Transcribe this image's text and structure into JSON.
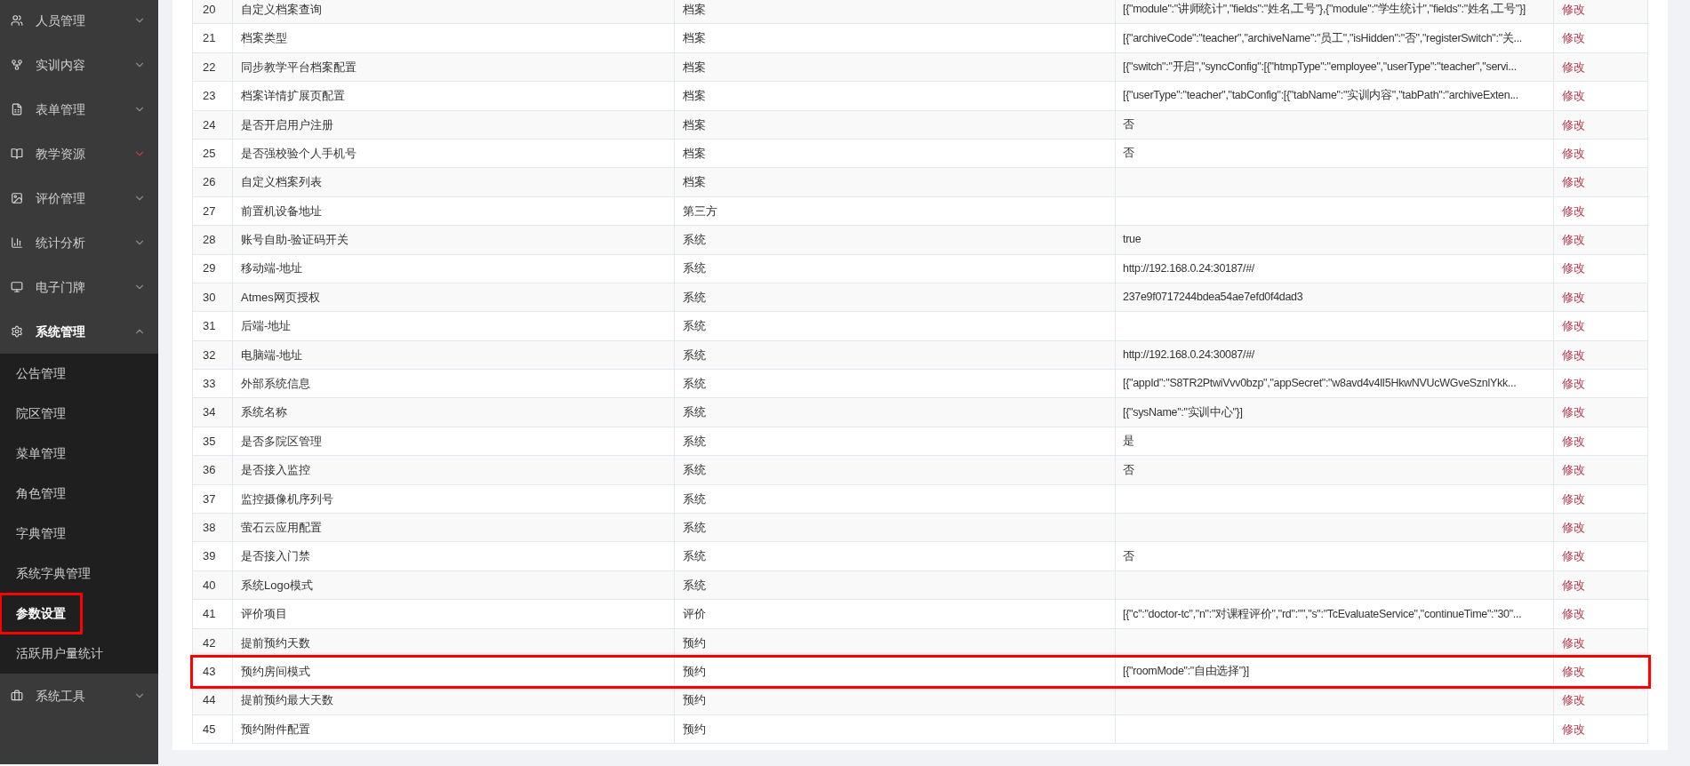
{
  "sidebar": {
    "items": [
      {
        "label": "人员管理",
        "expanded": false,
        "accent": false
      },
      {
        "label": "实训内容",
        "expanded": false,
        "accent": false
      },
      {
        "label": "表单管理",
        "expanded": false,
        "accent": false
      },
      {
        "label": "教学资源",
        "expanded": false,
        "accent": true
      },
      {
        "label": "评价管理",
        "expanded": false,
        "accent": false
      },
      {
        "label": "统计分析",
        "expanded": false,
        "accent": false
      },
      {
        "label": "电子门牌",
        "expanded": false,
        "accent": false
      },
      {
        "label": "系统管理",
        "expanded": true,
        "accent": false,
        "children": [
          {
            "label": "公告管理",
            "selected": false,
            "highlighted": false
          },
          {
            "label": "院区管理",
            "selected": false,
            "highlighted": false
          },
          {
            "label": "菜单管理",
            "selected": false,
            "highlighted": false
          },
          {
            "label": "角色管理",
            "selected": false,
            "highlighted": false
          },
          {
            "label": "字典管理",
            "selected": false,
            "highlighted": false
          },
          {
            "label": "系统字典管理",
            "selected": false,
            "highlighted": false
          },
          {
            "label": "参数设置",
            "selected": true,
            "highlighted": true
          },
          {
            "label": "活跃用户量统计",
            "selected": false,
            "highlighted": false
          }
        ]
      },
      {
        "label": "系统工具",
        "expanded": false,
        "accent": false
      }
    ]
  },
  "table": {
    "rows": [
      {
        "no": "20",
        "name": "自定义档案查询",
        "type": "档案",
        "value": "[{\"module\":\"讲师统计\",\"fields\":\"姓名,工号\"},{\"module\":\"学生统计\",\"fields\":\"姓名,工号\"}]",
        "action": "修改",
        "highlighted": false
      },
      {
        "no": "21",
        "name": "档案类型",
        "type": "档案",
        "value": "[{\"archiveCode\":\"teacher\",\"archiveName\":\"员工\",\"isHidden\":\"否\",\"registerSwitch\":\"关...",
        "action": "修改",
        "highlighted": false
      },
      {
        "no": "22",
        "name": "同步教学平台档案配置",
        "type": "档案",
        "value": "[{\"switch\":\"开启\",\"syncConfig\":[{\"htmpType\":\"employee\",\"userType\":\"teacher\",\"servi...",
        "action": "修改",
        "highlighted": false
      },
      {
        "no": "23",
        "name": "档案详情扩展页配置",
        "type": "档案",
        "value": "[{\"userType\":\"teacher\",\"tabConfig\":[{\"tabName\":\"实训内容\",\"tabPath\":\"archiveExten...",
        "action": "修改",
        "highlighted": false
      },
      {
        "no": "24",
        "name": "是否开启用户注册",
        "type": "档案",
        "value": "否",
        "action": "修改",
        "highlighted": false
      },
      {
        "no": "25",
        "name": "是否强校验个人手机号",
        "type": "档案",
        "value": "否",
        "action": "修改",
        "highlighted": false
      },
      {
        "no": "26",
        "name": "自定义档案列表",
        "type": "档案",
        "action": "修改",
        "highlighted": false
      },
      {
        "no": "27",
        "name": "前置机设备地址",
        "type": "第三方",
        "action": "修改",
        "highlighted": false
      },
      {
        "no": "28",
        "name": "账号自助-验证码开关",
        "type": "系统",
        "value": "true",
        "action": "修改",
        "highlighted": false
      },
      {
        "no": "29",
        "name": "移动端-地址",
        "type": "系统",
        "value": "http://192.168.0.24:30187/#/",
        "action": "修改",
        "highlighted": false
      },
      {
        "no": "30",
        "name": "Atmes网页授权",
        "type": "系统",
        "value": "237e9f0717244bdea54ae7efd0f4dad3",
        "action": "修改",
        "highlighted": false
      },
      {
        "no": "31",
        "name": "后端-地址",
        "type": "系统",
        "action": "修改",
        "highlighted": false
      },
      {
        "no": "32",
        "name": "电脑端-地址",
        "type": "系统",
        "value": "http://192.168.0.24:30087/#/",
        "action": "修改",
        "highlighted": false
      },
      {
        "no": "33",
        "name": "外部系统信息",
        "type": "系统",
        "value": "[{\"appId\":\"S8TR2PtwiVvv0bzp\",\"appSecret\":\"w8avd4v4lI5HkwNVUcWGveSznlYkk...",
        "action": "修改",
        "highlighted": false
      },
      {
        "no": "34",
        "name": "系统名称",
        "type": "系统",
        "value": "[{\"sysName\":\"实训中心\"}]",
        "action": "修改",
        "highlighted": false
      },
      {
        "no": "35",
        "name": "是否多院区管理",
        "type": "系统",
        "value": "是",
        "action": "修改",
        "highlighted": false
      },
      {
        "no": "36",
        "name": "是否接入监控",
        "type": "系统",
        "value": "否",
        "action": "修改",
        "highlighted": false
      },
      {
        "no": "37",
        "name": "监控摄像机序列号",
        "type": "系统",
        "action": "修改",
        "highlighted": false
      },
      {
        "no": "38",
        "name": "萤石云应用配置",
        "type": "系统",
        "action": "修改",
        "highlighted": false
      },
      {
        "no": "39",
        "name": "是否接入门禁",
        "type": "系统",
        "value": "否",
        "action": "修改",
        "highlighted": false
      },
      {
        "no": "40",
        "name": "系统Logo模式",
        "type": "系统",
        "action": "修改",
        "highlighted": false
      },
      {
        "no": "41",
        "name": "评价项目",
        "type": "评价",
        "value": "[{\"c\":\"doctor-tc\",\"n\":\"对课程评价\",\"rd\":\"\",\"s\":\"TcEvaluateService\",\"continueTime\":\"30\"...",
        "action": "修改",
        "highlighted": false
      },
      {
        "no": "42",
        "name": "提前预约天数",
        "type": "预约",
        "action": "修改",
        "highlighted": false
      },
      {
        "no": "43",
        "name": "预约房间模式",
        "type": "预约",
        "value": "[{\"roomMode\":\"自由选择\"}]",
        "action": "修改",
        "highlighted": true
      },
      {
        "no": "44",
        "name": "提前预约最大天数",
        "type": "预约",
        "action": "修改",
        "highlighted": false
      },
      {
        "no": "45",
        "name": "预约附件配置",
        "type": "预约",
        "action": "修改",
        "highlighted": false
      }
    ]
  }
}
